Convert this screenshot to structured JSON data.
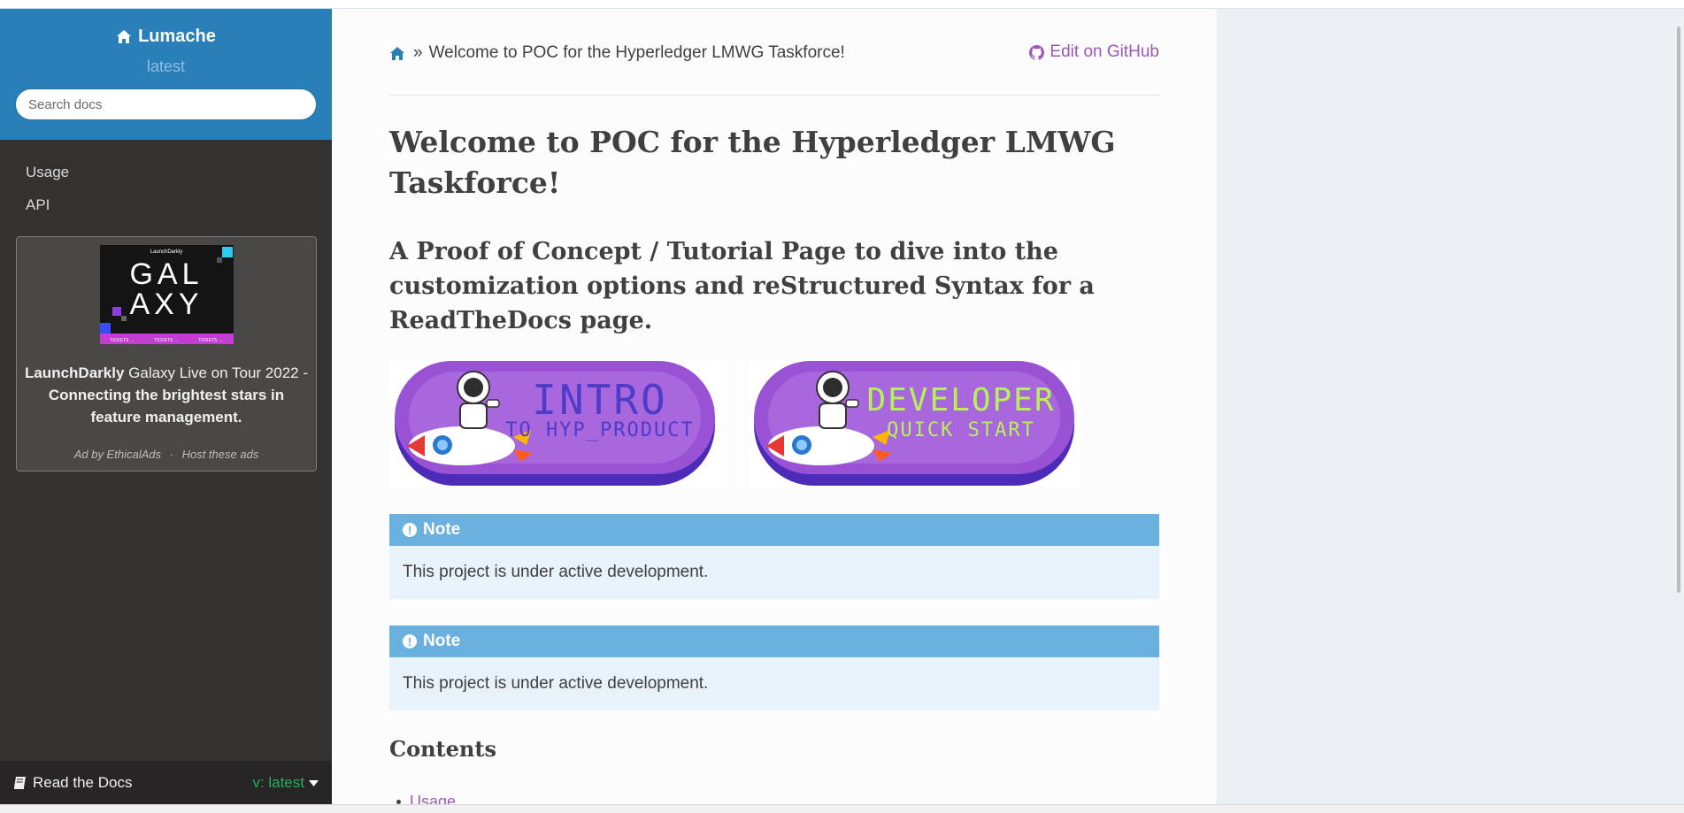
{
  "sidebar": {
    "brand": "Lumache",
    "version": "latest",
    "search_placeholder": "Search docs",
    "nav": [
      {
        "label": "Usage"
      },
      {
        "label": "API"
      }
    ],
    "ad": {
      "img_brand": "LaunchDarkly",
      "img_title_line1": "GAL",
      "img_title_line2": "AXY",
      "img_ticket": "TICKETS →",
      "sponsor": "LaunchDarkly",
      "headline": "Galaxy Live on Tour 2022 -",
      "tagline": "Connecting the brightest stars in feature management.",
      "ad_by": "Ad by EthicalAds",
      "separator": "·",
      "host": "Host these ads"
    },
    "footer": {
      "label": "Read the Docs",
      "version": "v: latest"
    }
  },
  "content": {
    "breadcrumb_sep": "»",
    "breadcrumb_current": "Welcome to POC for the Hyperledger LMWG Taskforce!",
    "edit_link": "Edit on GitHub",
    "title": "Welcome to POC for the Hyperledger LMWG Taskforce!",
    "subtitle": "A Proof of Concept / Tutorial Page to dive into the customization options and reStructured Syntax for a ReadTheDocs page.",
    "badges": [
      {
        "line1": "INTRO",
        "line2": "TO HYP_PRODUCT"
      },
      {
        "line1": "DEVELOPER",
        "line2": "QUICK START"
      }
    ],
    "notes": [
      {
        "title": "Note",
        "body": "This project is under active development."
      },
      {
        "title": "Note",
        "body": "This project is under active development."
      }
    ],
    "contents_heading": "Contents",
    "toc": [
      {
        "label": "Usage"
      }
    ]
  },
  "colors": {
    "sidebar_head": "#2980b9",
    "sidebar_bg": "#343131",
    "link": "#9b59b6",
    "note_title": "#6ab0de",
    "note_bg": "#e7f2fa",
    "rtd_version": "#27ae60"
  },
  "icons": [
    "home-icon",
    "github-icon",
    "book-icon",
    "caret-down-icon",
    "exclamation-circle-icon",
    "rocket-astronaut-icon"
  ]
}
